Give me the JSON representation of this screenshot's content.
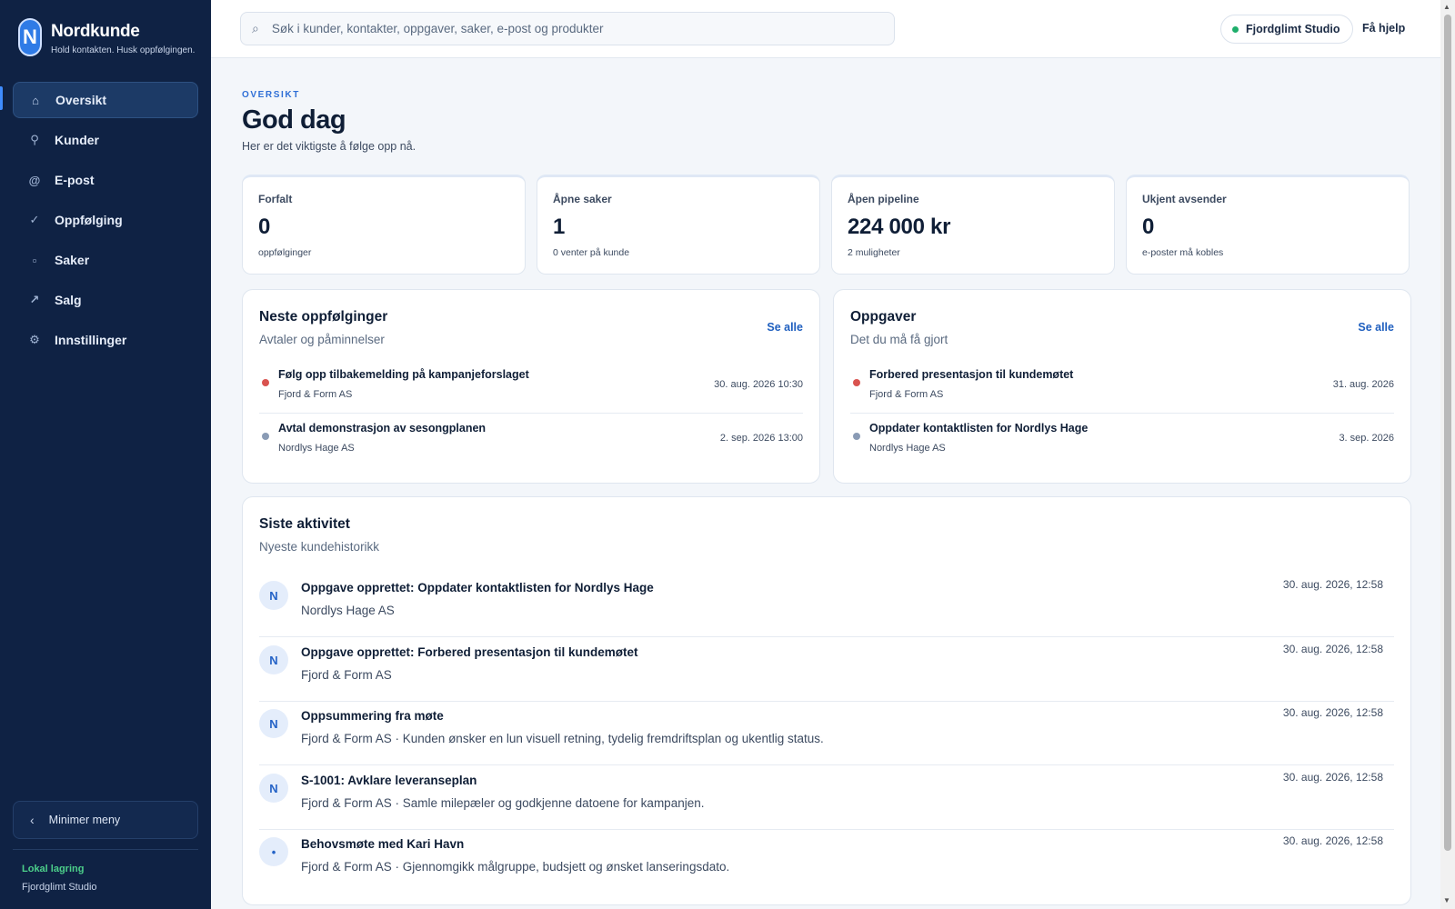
{
  "brand": {
    "logo_letter": "N",
    "title": "Nordkunde",
    "tagline": "Hold kontakten. Husk oppfølgingen."
  },
  "nav": [
    {
      "label": "Oversikt",
      "icon": "home-icon",
      "glyph": "⌂",
      "active": true
    },
    {
      "label": "Kunder",
      "icon": "person-icon",
      "glyph": "⚲"
    },
    {
      "label": "E-post",
      "icon": "at-icon",
      "glyph": "@"
    },
    {
      "label": "Oppfølging",
      "icon": "check-icon",
      "glyph": "✓"
    },
    {
      "label": "Saker",
      "icon": "folder-icon",
      "glyph": "▫"
    },
    {
      "label": "Salg",
      "icon": "trend-icon",
      "glyph": "↗"
    },
    {
      "label": "Innstillinger",
      "icon": "gear-icon",
      "glyph": "⚙"
    }
  ],
  "sidebar_footer": {
    "minimize_label": "Minimer meny",
    "storage_title": "Lokal lagring",
    "storage_workspace": "Fjordglimt Studio"
  },
  "topbar": {
    "search_placeholder": "Søk i kunder, kontakter, oppgaver, saker, e-post og produkter",
    "search_value": "",
    "workspace": "Fjordglimt Studio",
    "help": "Få hjelp"
  },
  "header": {
    "eyebrow": "OVERSIKT",
    "title": "God dag",
    "subtitle": "Her er det viktigste å følge opp nå."
  },
  "stats": [
    {
      "label": "Forfalt",
      "value": "0",
      "sub": "oppfølginger"
    },
    {
      "label": "Åpne saker",
      "value": "1",
      "sub": "0 venter på kunde"
    },
    {
      "label": "Åpen pipeline",
      "value": "224 000 kr",
      "sub": "2 muligheter"
    },
    {
      "label": "Ukjent avsender",
      "value": "0",
      "sub": "e-poster må kobles"
    }
  ],
  "followups": {
    "title": "Neste oppfølginger",
    "subtitle": "Avtaler og påminnelser",
    "see_all": "Se alle",
    "items": [
      {
        "title": "Følg opp tilbakemelding på kampanjeforslaget",
        "company": "Fjord & Form AS",
        "date": "30. aug. 2026 10:30",
        "status_color": "#d9534f"
      },
      {
        "title": "Avtal demonstrasjon av sesongplanen",
        "company": "Nordlys Hage AS",
        "date": "2. sep. 2026 13:00",
        "status_color": "#8a9bb5"
      }
    ]
  },
  "tasks": {
    "title": "Oppgaver",
    "subtitle": "Det du må få gjort",
    "see_all": "Se alle",
    "items": [
      {
        "title": "Forbered presentasjon til kundemøtet",
        "company": "Fjord & Form AS",
        "date": "31. aug. 2026",
        "status_color": "#d9534f"
      },
      {
        "title": "Oppdater kontaktlisten for Nordlys Hage",
        "company": "Nordlys Hage AS",
        "date": "3. sep. 2026",
        "status_color": "#8a9bb5"
      }
    ]
  },
  "activity": {
    "title": "Siste aktivitet",
    "subtitle": "Nyeste kundehistorikk",
    "items": [
      {
        "avatar": "N",
        "title": "Oppgave opprettet: Oppdater kontaktlisten for Nordlys Hage",
        "sub": "Nordlys Hage AS",
        "date": "30. aug. 2026, 12:58"
      },
      {
        "avatar": "N",
        "title": "Oppgave opprettet: Forbered presentasjon til kundemøtet",
        "sub": "Fjord & Form AS",
        "date": "30. aug. 2026, 12:58"
      },
      {
        "avatar": "N",
        "title": "Oppsummering fra møte",
        "sub": "Fjord & Form AS · Kunden ønsker en lun visuell retning, tydelig fremdriftsplan og ukentlig status.",
        "date": "30. aug. 2026, 12:58"
      },
      {
        "avatar": "N",
        "title": "S-1001: Avklare leveranseplan",
        "sub": "Fjord & Form AS · Samle milepæler og godkjenne datoene for kampanjen.",
        "date": "30. aug. 2026, 12:58"
      },
      {
        "avatar": "•",
        "title": "Behovsmøte med Kari Havn",
        "sub": "Fjord & Form AS · Gjennomgikk målgruppe, budsjett og ønsket lanseringsdato.",
        "date": "30. aug. 2026, 12:58"
      }
    ]
  }
}
